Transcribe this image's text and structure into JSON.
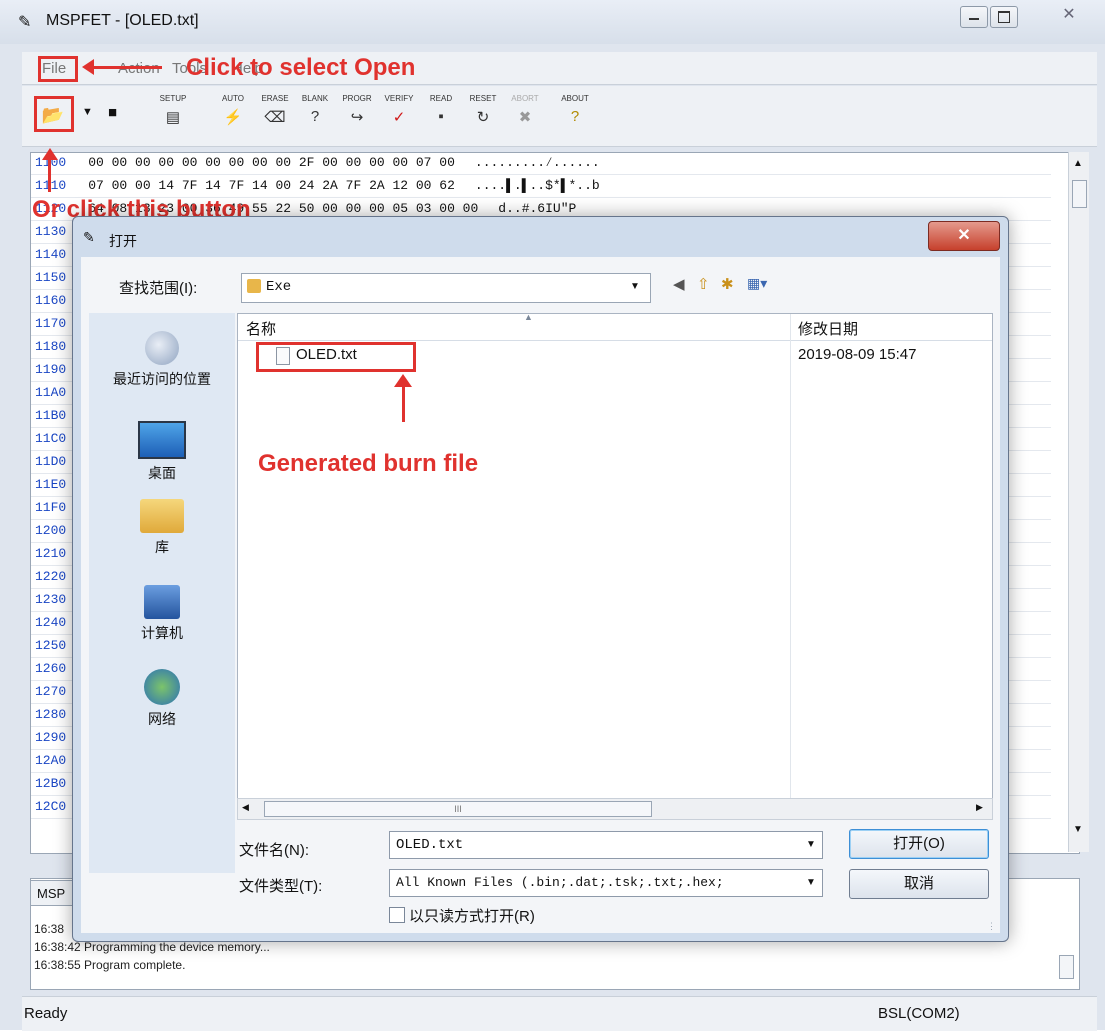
{
  "window": {
    "title": "MSPFET - [OLED.txt]"
  },
  "menu": [
    "File",
    "Action",
    "Tools",
    "Help"
  ],
  "toolbar": {
    "buttons": [
      "SETUP",
      "AUTO",
      "ERASE",
      "BLANK",
      "PROGR",
      "VERIFY",
      "READ",
      "RESET",
      "ABORT",
      "ABOUT"
    ]
  },
  "hex": {
    "rows": [
      {
        "addr": "1100",
        "bytes": "00 00 00 00 00 00 00 00 00 2F 00 00 00 00 07 00",
        "ascii": ".........⁄......"
      },
      {
        "addr": "1110",
        "bytes": "07 00 00 14 7F 14 7F 14 00 24 2A 7F 2A 12 00 62",
        "ascii": "....▌.▌..$*▌*..b"
      },
      {
        "addr": "1120",
        "bytes": "64 08 13 23 00 36 49 55 22 50 00 00 00 05 03 00 00",
        "ascii": "d..#.6IU\"P"
      },
      {
        "addr": "1130",
        "bytes": "",
        "ascii": ""
      },
      {
        "addr": "1140",
        "bytes": "",
        "ascii": ""
      },
      {
        "addr": "1150",
        "bytes": "",
        "ascii": ""
      },
      {
        "addr": "1160",
        "bytes": "",
        "ascii": ""
      },
      {
        "addr": "1170",
        "bytes": "",
        "ascii": ""
      },
      {
        "addr": "1180",
        "bytes": "",
        "ascii": ""
      },
      {
        "addr": "1190",
        "bytes": "",
        "ascii": ""
      },
      {
        "addr": "11A0",
        "bytes": "",
        "ascii": ""
      },
      {
        "addr": "11B0",
        "bytes": "",
        "ascii": ""
      },
      {
        "addr": "11C0",
        "bytes": "",
        "ascii": ""
      },
      {
        "addr": "11D0",
        "bytes": "",
        "ascii": ""
      },
      {
        "addr": "11E0",
        "bytes": "",
        "ascii": ""
      },
      {
        "addr": "11F0",
        "bytes": "",
        "ascii": ""
      },
      {
        "addr": "1200",
        "bytes": "",
        "ascii": ""
      },
      {
        "addr": "1210",
        "bytes": "",
        "ascii": ""
      },
      {
        "addr": "1220",
        "bytes": "",
        "ascii": ""
      },
      {
        "addr": "1230",
        "bytes": "",
        "ascii": ""
      },
      {
        "addr": "1240",
        "bytes": "",
        "ascii": ""
      },
      {
        "addr": "1250",
        "bytes": "",
        "ascii": ""
      },
      {
        "addr": "1260",
        "bytes": "",
        "ascii": ""
      },
      {
        "addr": "1270",
        "bytes": "",
        "ascii": ""
      },
      {
        "addr": "1280",
        "bytes": "",
        "ascii": ""
      },
      {
        "addr": "1290",
        "bytes": "",
        "ascii": ""
      },
      {
        "addr": "12A0",
        "bytes": "",
        "ascii": ""
      },
      {
        "addr": "12B0",
        "bytes": "",
        "ascii": ""
      },
      {
        "addr": "12C0",
        "bytes": "",
        "ascii": ""
      }
    ]
  },
  "log": {
    "tab": "MSP",
    "lines": [
      "16:38",
      "16:38:42  Programming the device memory...",
      "16:38:55  Program complete."
    ]
  },
  "status": {
    "left": "Ready",
    "right": "BSL(COM2)"
  },
  "dialog": {
    "title": "打开",
    "lookin_label": "查找范围(I):",
    "lookin_value": "Exe",
    "places": [
      "最近访问的位置",
      "桌面",
      "库",
      "计算机",
      "网络"
    ],
    "columns": [
      "名称",
      "修改日期"
    ],
    "files": [
      {
        "name": "OLED.txt",
        "date": "2019-08-09 15:47"
      }
    ],
    "hscroll_grip": "III",
    "filename_label": "文件名(N):",
    "filename_value": "OLED.txt",
    "filetype_label": "文件类型(T):",
    "filetype_value": "All Known Files (.bin;.dat;.tsk;.txt;.hex;",
    "readonly_label": "以只读方式打开(R)",
    "open_button": "打开(O)",
    "cancel_button": "取消"
  },
  "annotations": {
    "select_open": "Click to select Open",
    "click_button": "Or click this button",
    "burn_file": "Generated burn file"
  },
  "colors": {
    "annotation": "#e0322e",
    "hex_address": "#1a46c4"
  }
}
